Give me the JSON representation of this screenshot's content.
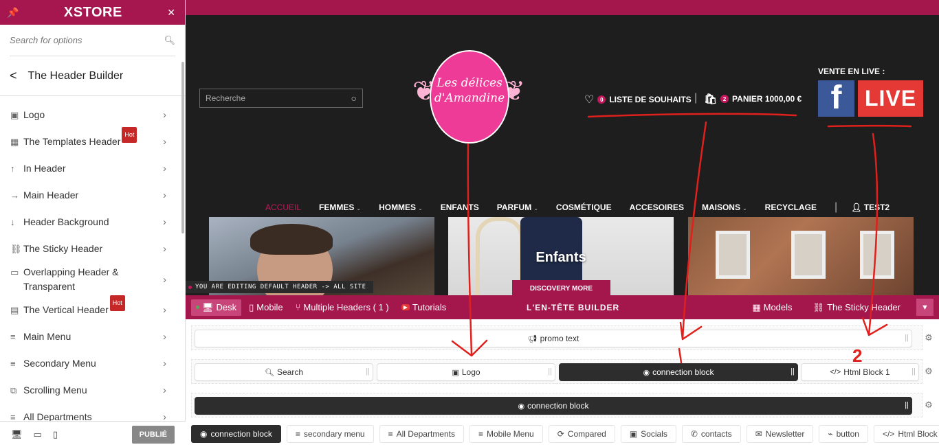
{
  "sidebar": {
    "logo": "XSTORE",
    "search_placeholder": "Search for options",
    "section_title": "The Header Builder",
    "items": [
      {
        "icon": "▣",
        "label": "Logo",
        "hot": ""
      },
      {
        "icon": "▦",
        "label": "The Templates Header",
        "hot": "Hot"
      },
      {
        "icon": "↑",
        "label": "In Header",
        "hot": ""
      },
      {
        "icon": "→",
        "label": "Main Header",
        "hot": ""
      },
      {
        "icon": "↓",
        "label": "Header Background",
        "hot": ""
      },
      {
        "icon": "⛓",
        "label": "The Sticky Header",
        "hot": ""
      },
      {
        "icon": "▭",
        "label": "Overlapping Header & Transparent",
        "hot": ""
      },
      {
        "icon": "▤",
        "label": "The Vertical Header",
        "hot": "Hot"
      },
      {
        "icon": "≡",
        "label": "Main Menu",
        "hot": ""
      },
      {
        "icon": "≡",
        "label": "Secondary Menu",
        "hot": ""
      },
      {
        "icon": "⧉",
        "label": "Scrolling Menu",
        "hot": ""
      },
      {
        "icon": "≡",
        "label": "All Departments",
        "hot": ""
      }
    ],
    "publish_label": "PUBLIÉ"
  },
  "preview": {
    "search_placeholder": "Recherche",
    "logo_line1": "Les délices",
    "logo_line2": "d'Amandine",
    "wishlist_count": "0",
    "wishlist_label": "LISTE DE SOUHAITS",
    "cart_count": "2",
    "cart_label": "PANIER 1000,00 €",
    "live_label": "VENTE EN LIVE :",
    "fb_letter": "f",
    "live_button": "LIVE",
    "nav": [
      "ACCUEIL",
      "FEMMES",
      "HOMMES",
      "ENFANTS",
      "PARFUM",
      "COSMÉTIQUE",
      "ACCESOIRES",
      "MAISONS",
      "RECYCLAGE"
    ],
    "account_label": "TEST2",
    "banner_title": "Enfants",
    "banner_button": "DISCOVERY MORE",
    "edit_notice": "YOU ARE EDITING DEFAULT HEADER -> ALL SITE"
  },
  "builder": {
    "tabs": {
      "desk": "Desk",
      "mobile": "Mobile",
      "multiple": "Multiple Headers ( 1 )",
      "tutorials": "Tutorials"
    },
    "title": "L'EN-TÊTE BUILDER",
    "models": "Models",
    "sticky": "The Sticky Header",
    "row1": {
      "promo": "promo text"
    },
    "row2": {
      "search": "Search",
      "logo": "Logo",
      "connection": "connection block",
      "html": "Html Block 1"
    },
    "row3": {
      "connection": "connection block"
    },
    "tray": [
      "connection block",
      "secondary menu",
      "All Departments",
      "Mobile Menu",
      "Compared",
      "Socials",
      "contacts",
      "Newsletter",
      "button",
      "Html Block"
    ]
  },
  "annotations": {
    "number": "2"
  }
}
